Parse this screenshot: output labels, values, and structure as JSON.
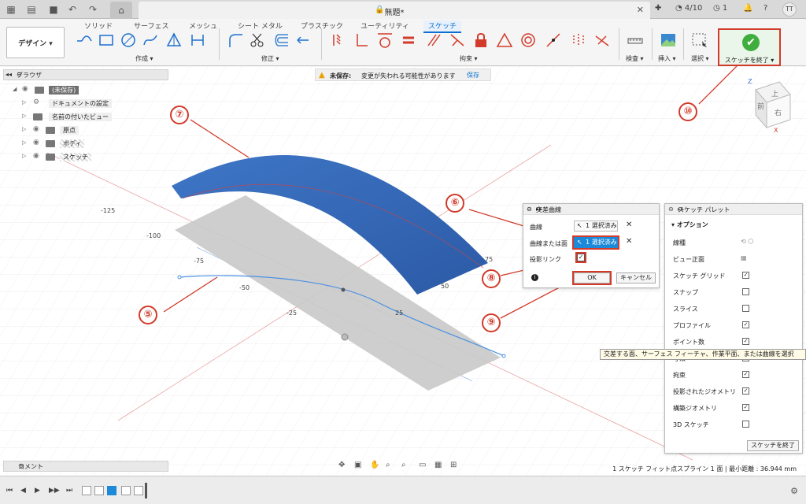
{
  "titlebar": {
    "doc_title": "無題*",
    "job_count": "4/10",
    "clock_count": "1",
    "user_initials": "TT"
  },
  "ribbon": {
    "tabs": [
      "ソリッド",
      "サーフェス",
      "メッシュ",
      "シート メタル",
      "プラスチック",
      "ユーティリティ",
      "スケッチ"
    ],
    "design_label": "デザイン ▾",
    "groups": {
      "create": "作成 ▾",
      "modify": "修正 ▾",
      "constraints": "拘束 ▾",
      "inspect": "検査 ▾",
      "insert": "挿入 ▾",
      "select": "選択 ▾"
    },
    "finish_sketch": "スケッチを終了 ▾"
  },
  "browser": {
    "title": "ブラウザ",
    "items": [
      {
        "label": "(未保存)"
      },
      {
        "label": "ドキュメントの設定"
      },
      {
        "label": "名前の付いたビュー"
      },
      {
        "label": "原点"
      },
      {
        "label": "ボディ"
      },
      {
        "label": "スケッチ"
      }
    ]
  },
  "unsaved": {
    "strong": "未保存:",
    "message": "変更が失われる可能性があります",
    "save": "保存"
  },
  "axis_ticks": [
    "-125",
    "-100",
    "-75",
    "-50",
    "-25",
    "25",
    "50",
    "75"
  ],
  "viewcube": {
    "top": "上",
    "front": "前",
    "right": "右",
    "x": "X",
    "z": "Z"
  },
  "dialog": {
    "title": "交差曲線",
    "curve_label": "曲線",
    "curve_value": "1 選択済み",
    "face_label": "曲線または面",
    "face_value": "1 選択済み",
    "projection_label": "投影リンク",
    "projection_checked": true,
    "ok": "OK",
    "cancel": "キャンセル"
  },
  "tooltip": "交差する面、サーフェス フィーチャ、作業平面、または曲線を選択",
  "palette": {
    "title": "スケッチ パレット",
    "section": "オプション",
    "rows": [
      {
        "label": "線種",
        "type": "icon"
      },
      {
        "label": "ビュー正面",
        "type": "icon"
      },
      {
        "label": "スケッチ グリッド",
        "type": "check",
        "checked": true
      },
      {
        "label": "スナップ",
        "type": "check",
        "checked": false
      },
      {
        "label": "スライス",
        "type": "check",
        "checked": false
      },
      {
        "label": "プロファイル",
        "type": "check",
        "checked": true
      },
      {
        "label": "ポイント数",
        "type": "check",
        "checked": true
      },
      {
        "label": "寸法",
        "type": "check",
        "checked": true
      },
      {
        "label": "拘束",
        "type": "check",
        "checked": true
      },
      {
        "label": "投影されたジオメトリ",
        "type": "check",
        "checked": true
      },
      {
        "label": "構築ジオメトリ",
        "type": "check",
        "checked": true
      },
      {
        "label": "3D スケッチ",
        "type": "check",
        "checked": false
      }
    ],
    "finish": "スケッチを終了"
  },
  "comments": {
    "title": "コメント"
  },
  "status": "1 スケッチ フィット点スプライン 1 面 | 最小距離 : 36.944 mm",
  "callouts": [
    "⑤",
    "⑥",
    "⑦",
    "⑧",
    "⑨",
    "⑩"
  ],
  "colors": {
    "accent": "#0a6fd0",
    "surface": "#3a6fbd",
    "callout": "#d23a2a"
  }
}
